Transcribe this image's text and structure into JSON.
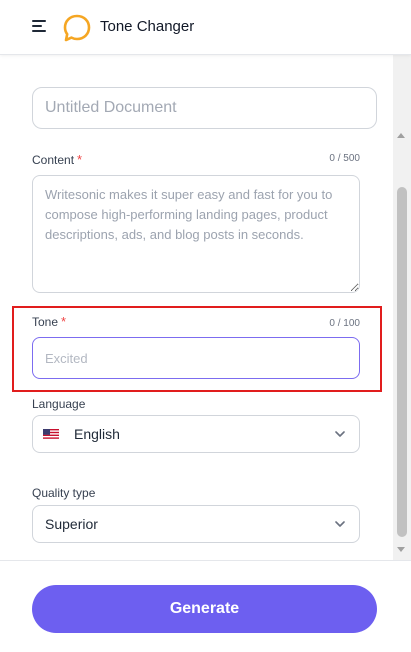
{
  "app": {
    "title": "Tone Changer"
  },
  "form": {
    "title_placeholder": "Untitled Document",
    "content": {
      "label": "Content",
      "required_mark": "*",
      "counter": "0 / 500",
      "placeholder": "Writesonic makes it super easy and fast for you to compose high-performing landing pages, product descriptions, ads, and blog posts in seconds."
    },
    "tone": {
      "label": "Tone",
      "required_mark": "*",
      "counter": "0 / 100",
      "placeholder": "Excited"
    },
    "language": {
      "label": "Language",
      "selected": "English",
      "flag": "us-flag-icon"
    },
    "quality": {
      "label": "Quality type",
      "selected": "Superior"
    }
  },
  "footer": {
    "generate_label": "Generate"
  },
  "colors": {
    "accent": "#6d5ff0",
    "logo": "#f5a623",
    "highlight": "#e11d1d",
    "required": "#ef4444"
  }
}
